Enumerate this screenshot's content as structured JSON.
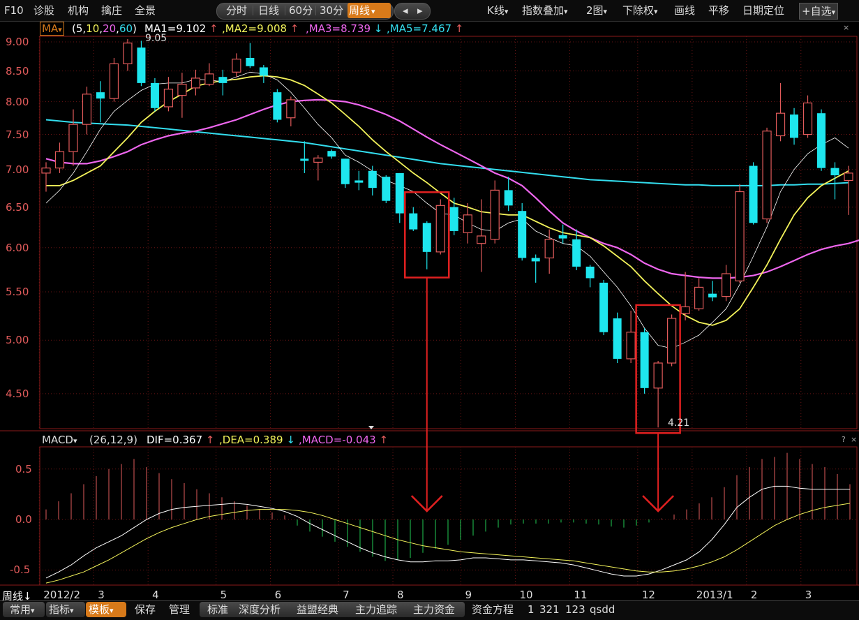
{
  "toolbar": {
    "left_items": [
      "F10",
      "诊股",
      "机构",
      "擒庄",
      "全景"
    ],
    "period_tabs": [
      "分时",
      "日线",
      "60分",
      "30分",
      "周线"
    ],
    "period_selected": "周线",
    "nav_arrows": [
      "◂",
      "▸"
    ],
    "right_items": [
      "K线",
      "指数叠加",
      "2图",
      "下除权",
      "画线",
      "平移",
      "日期定位",
      "自选"
    ],
    "dropdown_glyph": "▾",
    "plus_glyph": "+"
  },
  "main_info": {
    "indicator": "MA",
    "params": [
      "5",
      "10",
      "20",
      "60"
    ],
    "ma1_label": "MA1=9.102",
    "ma2_label": ",MA2=9.008",
    "ma3_label": ",MA3=8.739",
    "ma5_label": ",MA5=7.467",
    "arrows": [
      "↑",
      "↑",
      "↓",
      "↑"
    ],
    "params_prefix": "(",
    "params_suffix": ")",
    "param_sep": ","
  },
  "macd_info": {
    "indicator": "MACD",
    "params": "(26,12,9)",
    "dif_label": "DIF=0.367",
    "dea_label": ",DEA=0.389",
    "macd_label": ",MACD=-0.043",
    "arrows": [
      "↑",
      "↓",
      "↑"
    ]
  },
  "corner_glyphs": [
    "?",
    "×"
  ],
  "price_axis": [
    "9.00",
    "8.50",
    "8.00",
    "7.50",
    "7.00",
    "6.50",
    "6.00",
    "5.50",
    "5.00",
    "4.50"
  ],
  "macd_axis": [
    "0.5",
    "0.0",
    "-0.5"
  ],
  "time_axis": {
    "period_label": "周线",
    "period_arrow": "↓",
    "labels": [
      "2012/2",
      "3",
      "4",
      "5",
      "6",
      "7",
      "8",
      "9",
      "10",
      "11",
      "12",
      "2013/1",
      "2",
      "3"
    ]
  },
  "annotations": {
    "high": "9.05",
    "low": "4.21"
  },
  "bottom_bar": {
    "left": [
      "常用",
      "指标",
      "模板"
    ],
    "left_selected": "模板",
    "actions": [
      "保存",
      "管理"
    ],
    "tabs": [
      "标准",
      "深度分析",
      "益盟经典",
      "主力追踪",
      "主力资金",
      "资金方程"
    ],
    "extra": [
      "1",
      "321",
      "123",
      "qsdd"
    ]
  },
  "colors": {
    "up": "#e25b5b",
    "down": "#1ee6ee",
    "ma5": "#ffffff",
    "ma10": "#f2f25a",
    "ma20": "#ee66ee",
    "ma60": "#33ddee",
    "box": "#e02020",
    "dif": "#ffffff",
    "dea": "#f2f25a"
  },
  "chart_data": [
    {
      "type": "candlestick",
      "title": "周线",
      "ylim": [
        4.2,
        9.1
      ],
      "candles": [
        {
          "o": 6.95,
          "c": 7.02,
          "h": 7.1,
          "l": 6.7
        },
        {
          "o": 7.02,
          "c": 7.25,
          "h": 7.38,
          "l": 6.95
        },
        {
          "o": 7.25,
          "c": 7.65,
          "h": 7.88,
          "l": 7.05
        },
        {
          "o": 7.65,
          "c": 8.12,
          "h": 8.24,
          "l": 7.5
        },
        {
          "o": 8.15,
          "c": 8.05,
          "h": 8.33,
          "l": 7.68
        },
        {
          "o": 8.05,
          "c": 8.62,
          "h": 8.72,
          "l": 8.0
        },
        {
          "o": 8.62,
          "c": 8.98,
          "h": 9.05,
          "l": 8.5
        },
        {
          "o": 8.9,
          "c": 8.3,
          "h": 9.02,
          "l": 8.25
        },
        {
          "o": 8.3,
          "c": 7.9,
          "h": 8.38,
          "l": 7.85
        },
        {
          "o": 7.92,
          "c": 8.2,
          "h": 8.4,
          "l": 7.85
        },
        {
          "o": 8.1,
          "c": 8.28,
          "h": 8.47,
          "l": 7.75
        },
        {
          "o": 8.22,
          "c": 8.38,
          "h": 8.52,
          "l": 8.1
        },
        {
          "o": 8.28,
          "c": 8.45,
          "h": 8.63,
          "l": 8.25
        },
        {
          "o": 8.4,
          "c": 8.3,
          "h": 8.52,
          "l": 8.1
        },
        {
          "o": 8.48,
          "c": 8.7,
          "h": 8.8,
          "l": 8.4
        },
        {
          "o": 8.72,
          "c": 8.58,
          "h": 8.98,
          "l": 8.55
        },
        {
          "o": 8.56,
          "c": 8.42,
          "h": 8.6,
          "l": 8.3
        },
        {
          "o": 8.15,
          "c": 7.72,
          "h": 8.2,
          "l": 7.68
        },
        {
          "o": 7.75,
          "c": 8.03,
          "h": 8.08,
          "l": 7.62
        },
        {
          "o": 7.15,
          "c": 7.12,
          "h": 7.4,
          "l": 6.95
        },
        {
          "o": 7.1,
          "c": 7.16,
          "h": 7.2,
          "l": 6.85
        },
        {
          "o": 7.26,
          "c": 7.18,
          "h": 7.28,
          "l": 7.15
        },
        {
          "o": 7.15,
          "c": 6.8,
          "h": 7.15,
          "l": 6.75
        },
        {
          "o": 6.85,
          "c": 6.82,
          "h": 6.98,
          "l": 6.72
        },
        {
          "o": 6.98,
          "c": 6.75,
          "h": 7.05,
          "l": 6.65
        },
        {
          "o": 6.9,
          "c": 6.58,
          "h": 6.92,
          "l": 6.55
        },
        {
          "o": 6.95,
          "c": 6.42,
          "h": 6.95,
          "l": 6.3
        },
        {
          "o": 6.42,
          "c": 6.22,
          "h": 6.5,
          "l": 6.2
        },
        {
          "o": 6.3,
          "c": 5.95,
          "h": 6.32,
          "l": 5.75
        },
        {
          "o": 5.95,
          "c": 6.52,
          "h": 6.6,
          "l": 5.92
        },
        {
          "o": 6.5,
          "c": 6.2,
          "h": 6.62,
          "l": 6.15
        },
        {
          "o": 6.18,
          "c": 6.4,
          "h": 6.55,
          "l": 6.05
        },
        {
          "o": 6.05,
          "c": 6.14,
          "h": 6.6,
          "l": 5.72
        },
        {
          "o": 6.1,
          "c": 6.72,
          "h": 6.85,
          "l": 6.05
        },
        {
          "o": 6.72,
          "c": 6.52,
          "h": 6.9,
          "l": 6.45
        },
        {
          "o": 6.45,
          "c": 5.88,
          "h": 6.55,
          "l": 5.85
        },
        {
          "o": 5.88,
          "c": 5.84,
          "h": 5.92,
          "l": 5.6
        },
        {
          "o": 5.88,
          "c": 6.1,
          "h": 6.22,
          "l": 5.7
        },
        {
          "o": 6.15,
          "c": 6.11,
          "h": 6.28,
          "l": 6.05
        },
        {
          "o": 6.1,
          "c": 5.78,
          "h": 6.22,
          "l": 5.74
        },
        {
          "o": 5.78,
          "c": 5.65,
          "h": 5.8,
          "l": 5.55
        },
        {
          "o": 5.6,
          "c": 5.08,
          "h": 5.63,
          "l": 5.05
        },
        {
          "o": 5.22,
          "c": 4.82,
          "h": 5.28,
          "l": 4.78
        },
        {
          "o": 4.82,
          "c": 5.08,
          "h": 5.3,
          "l": 4.78
        },
        {
          "o": 5.08,
          "c": 4.55,
          "h": 5.12,
          "l": 4.5
        },
        {
          "o": 4.55,
          "c": 4.78,
          "h": 4.8,
          "l": 4.21
        },
        {
          "o": 4.78,
          "c": 5.22,
          "h": 5.26,
          "l": 4.75
        },
        {
          "o": 5.27,
          "c": 5.34,
          "h": 5.72,
          "l": 5.2
        },
        {
          "o": 5.32,
          "c": 5.55,
          "h": 5.65,
          "l": 5.3
        },
        {
          "o": 5.48,
          "c": 5.44,
          "h": 5.62,
          "l": 5.4
        },
        {
          "o": 5.45,
          "c": 5.7,
          "h": 5.8,
          "l": 5.4
        },
        {
          "o": 5.62,
          "c": 6.7,
          "h": 6.8,
          "l": 5.6
        },
        {
          "o": 7.05,
          "c": 6.3,
          "h": 7.1,
          "l": 6.28
        },
        {
          "o": 6.35,
          "c": 7.55,
          "h": 7.6,
          "l": 6.3
        },
        {
          "o": 7.48,
          "c": 7.82,
          "h": 8.3,
          "l": 7.4
        },
        {
          "o": 7.8,
          "c": 7.45,
          "h": 7.9,
          "l": 7.35
        },
        {
          "o": 7.5,
          "c": 7.98,
          "h": 8.1,
          "l": 7.45
        },
        {
          "o": 7.82,
          "c": 7.02,
          "h": 7.88,
          "l": 6.98
        },
        {
          "o": 7.02,
          "c": 6.92,
          "h": 7.1,
          "l": 6.6
        },
        {
          "o": 6.85,
          "c": 6.95,
          "h": 7.05,
          "l": 6.4
        }
      ],
      "ma5": [
        6.55,
        6.72,
        6.95,
        7.25,
        7.58,
        7.85,
        8.02,
        8.18,
        8.28,
        8.3,
        8.3,
        8.36,
        8.35,
        8.32,
        8.4,
        8.48,
        8.45,
        8.35,
        8.15,
        7.9,
        7.65,
        7.45,
        7.2,
        7.1,
        6.98,
        6.85,
        6.78,
        6.7,
        6.55,
        6.42,
        6.4,
        6.3,
        6.22,
        6.2,
        6.3,
        6.35,
        6.2,
        6.12,
        6.05,
        6.02,
        5.9,
        5.72,
        5.55,
        5.35,
        5.12,
        4.95,
        4.92,
        4.98,
        5.05,
        5.18,
        5.32,
        5.58,
        5.9,
        6.25,
        6.7,
        7.0,
        7.22,
        7.35,
        7.45,
        7.3
      ],
      "ma10": [
        6.78,
        6.78,
        6.85,
        6.95,
        7.05,
        7.25,
        7.45,
        7.68,
        7.85,
        8.0,
        8.12,
        8.25,
        8.3,
        8.34,
        8.36,
        8.4,
        8.42,
        8.4,
        8.35,
        8.26,
        8.12,
        7.98,
        7.8,
        7.62,
        7.42,
        7.25,
        7.1,
        6.95,
        6.82,
        6.68,
        6.55,
        6.5,
        6.44,
        6.42,
        6.4,
        6.4,
        6.32,
        6.24,
        6.18,
        6.15,
        6.12,
        6.02,
        5.9,
        5.78,
        5.62,
        5.48,
        5.35,
        5.25,
        5.18,
        5.15,
        5.2,
        5.32,
        5.55,
        5.8,
        6.1,
        6.4,
        6.62,
        6.78,
        6.88,
        6.98
      ],
      "ma20": [
        7.15,
        7.1,
        7.08,
        7.08,
        7.12,
        7.18,
        7.25,
        7.35,
        7.42,
        7.48,
        7.52,
        7.55,
        7.6,
        7.66,
        7.72,
        7.8,
        7.88,
        7.95,
        8.0,
        8.02,
        8.03,
        8.02,
        8.0,
        7.95,
        7.88,
        7.8,
        7.7,
        7.58,
        7.46,
        7.35,
        7.25,
        7.15,
        7.05,
        6.95,
        6.88,
        6.78,
        6.62,
        6.45,
        6.3,
        6.2,
        6.12,
        6.05,
        6.0,
        5.92,
        5.82,
        5.75,
        5.7,
        5.68,
        5.66,
        5.65,
        5.65,
        5.66,
        5.68,
        5.72,
        5.78,
        5.85,
        5.92,
        5.98,
        6.02,
        6.05,
        6.1
      ],
      "ma60": [
        7.72,
        7.7,
        7.68,
        7.67,
        7.66,
        7.65,
        7.64,
        7.62,
        7.6,
        7.58,
        7.56,
        7.54,
        7.52,
        7.5,
        7.48,
        7.46,
        7.44,
        7.42,
        7.4,
        7.38,
        7.35,
        7.32,
        7.29,
        7.26,
        7.23,
        7.2,
        7.17,
        7.14,
        7.11,
        7.08,
        7.06,
        7.04,
        7.02,
        7.0,
        6.98,
        6.96,
        6.94,
        6.92,
        6.9,
        6.88,
        6.86,
        6.85,
        6.84,
        6.83,
        6.82,
        6.81,
        6.8,
        6.79,
        6.79,
        6.78,
        6.78,
        6.78,
        6.78,
        6.78,
        6.79,
        6.79,
        6.8,
        6.8,
        6.81,
        6.82
      ]
    },
    {
      "type": "bar",
      "title": "MACD",
      "ylim": [
        -0.65,
        0.72
      ],
      "macd": [
        0.1,
        0.18,
        0.26,
        0.35,
        0.43,
        0.5,
        0.55,
        0.6,
        0.52,
        0.46,
        0.4,
        0.36,
        0.3,
        0.26,
        0.22,
        0.18,
        0.14,
        0.1,
        0.07,
        0.04,
        -0.06,
        -0.12,
        -0.17,
        -0.22,
        -0.27,
        -0.32,
        -0.37,
        -0.41,
        -0.4,
        -0.38,
        -0.33,
        -0.29,
        -0.25,
        -0.2,
        -0.16,
        -0.12,
        -0.08,
        -0.05,
        -0.04,
        -0.04,
        -0.04,
        -0.03,
        -0.03,
        -0.04,
        -0.05,
        -0.07,
        -0.08,
        -0.06,
        -0.03,
        0.01,
        0.05,
        0.1,
        0.16,
        0.22,
        0.32,
        0.44,
        0.52,
        0.6,
        0.62,
        0.66,
        0.6,
        0.55,
        0.52,
        0.45,
        0.35
      ],
      "dif": [
        -0.58,
        -0.52,
        -0.45,
        -0.36,
        -0.28,
        -0.22,
        -0.16,
        -0.08,
        0.0,
        0.06,
        0.1,
        0.12,
        0.13,
        0.14,
        0.15,
        0.16,
        0.15,
        0.13,
        0.11,
        0.08,
        0.03,
        -0.04,
        -0.1,
        -0.16,
        -0.22,
        -0.28,
        -0.33,
        -0.37,
        -0.4,
        -0.42,
        -0.42,
        -0.41,
        -0.41,
        -0.4,
        -0.38,
        -0.38,
        -0.39,
        -0.4,
        -0.4,
        -0.41,
        -0.42,
        -0.43,
        -0.45,
        -0.48,
        -0.51,
        -0.54,
        -0.56,
        -0.56,
        -0.54,
        -0.5,
        -0.45,
        -0.4,
        -0.32,
        -0.2,
        -0.05,
        0.12,
        0.22,
        0.3,
        0.33,
        0.33,
        0.31,
        0.3,
        0.3,
        0.3,
        0.3
      ],
      "dea": [
        -0.63,
        -0.6,
        -0.56,
        -0.52,
        -0.46,
        -0.4,
        -0.33,
        -0.26,
        -0.19,
        -0.13,
        -0.08,
        -0.04,
        0.0,
        0.03,
        0.05,
        0.07,
        0.09,
        0.1,
        0.1,
        0.1,
        0.09,
        0.07,
        0.04,
        0.0,
        -0.04,
        -0.08,
        -0.12,
        -0.16,
        -0.2,
        -0.23,
        -0.26,
        -0.28,
        -0.3,
        -0.32,
        -0.33,
        -0.34,
        -0.35,
        -0.36,
        -0.37,
        -0.38,
        -0.39,
        -0.4,
        -0.41,
        -0.43,
        -0.45,
        -0.47,
        -0.49,
        -0.51,
        -0.52,
        -0.52,
        -0.51,
        -0.49,
        -0.46,
        -0.42,
        -0.37,
        -0.3,
        -0.22,
        -0.14,
        -0.06,
        0.0,
        0.05,
        0.09,
        0.12,
        0.14,
        0.16
      ]
    }
  ]
}
